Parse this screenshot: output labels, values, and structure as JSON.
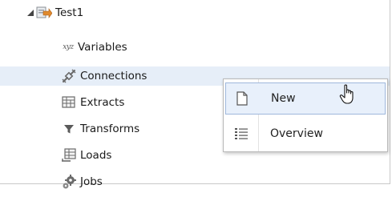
{
  "tree": {
    "root": {
      "label": "Test1",
      "icon": "project-icon",
      "expanded": true
    },
    "children": [
      {
        "label": "Variables",
        "icon": "xyz-icon",
        "icon_text": "xyz"
      },
      {
        "label": "Connections",
        "icon": "connection-plug-icon",
        "selected": true
      },
      {
        "label": "Extracts",
        "icon": "extracts-table-icon"
      },
      {
        "label": "Transforms",
        "icon": "filter-funnel-icon"
      },
      {
        "label": "Loads",
        "icon": "loads-table-icon"
      },
      {
        "label": "Jobs",
        "icon": "gears-icon"
      }
    ]
  },
  "context_menu": {
    "items": [
      {
        "label": "New",
        "icon": "new-document-icon",
        "hovered": true
      },
      {
        "label": "Overview",
        "icon": "list-icon"
      }
    ]
  },
  "colors": {
    "selection": "#e6eef8",
    "menu_hover": "#e8f0fb",
    "icon_gray": "#5a5a5a"
  }
}
